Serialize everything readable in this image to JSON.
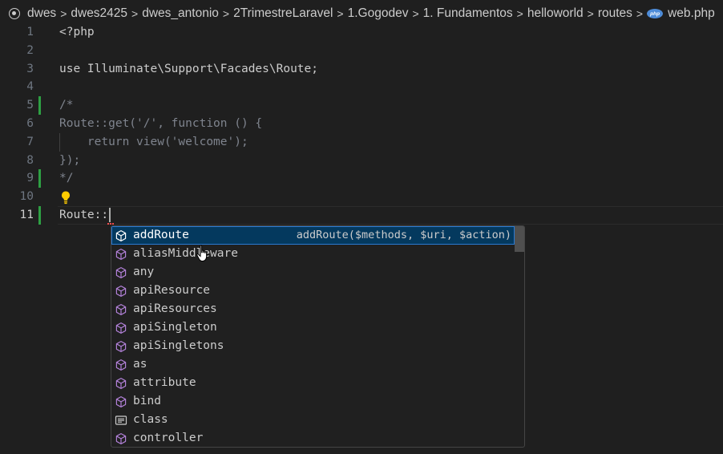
{
  "breadcrumb": {
    "items": [
      "dwes",
      "dwes2425",
      "dwes_antonio",
      "2TrimestreLaravel",
      "1.Gogodev",
      "1. Fundamentos",
      "helloworld",
      "routes"
    ],
    "file_badge": "php",
    "file_name": "web.php"
  },
  "editor": {
    "lines": [
      {
        "num": "1",
        "text": "<?php"
      },
      {
        "num": "2",
        "text": ""
      },
      {
        "num": "3",
        "text": "use Illuminate\\Support\\Facades\\Route;"
      },
      {
        "num": "4",
        "text": ""
      },
      {
        "num": "5",
        "text": "/*"
      },
      {
        "num": "6",
        "text": "Route::get('/', function () {"
      },
      {
        "num": "7",
        "text": "    return view('welcome');"
      },
      {
        "num": "8",
        "text": "});"
      },
      {
        "num": "9",
        "text": "*/"
      },
      {
        "num": "10",
        "text": ""
      },
      {
        "num": "11",
        "text": "Route::"
      }
    ]
  },
  "suggest": {
    "selected_detail": "addRoute($methods, $uri, $action)",
    "items": [
      {
        "label": "addRoute",
        "kind": "method-icon"
      },
      {
        "label": "aliasMiddleware",
        "kind": "method-icon"
      },
      {
        "label": "any",
        "kind": "method-icon"
      },
      {
        "label": "apiResource",
        "kind": "method-icon"
      },
      {
        "label": "apiResources",
        "kind": "method-icon"
      },
      {
        "label": "apiSingleton",
        "kind": "method-icon"
      },
      {
        "label": "apiSingletons",
        "kind": "method-icon"
      },
      {
        "label": "as",
        "kind": "method-icon"
      },
      {
        "label": "attribute",
        "kind": "method-icon"
      },
      {
        "label": "bind",
        "kind": "method-icon"
      },
      {
        "label": "class",
        "kind": "class-keyword-icon"
      },
      {
        "label": "controller",
        "kind": "method-icon"
      }
    ]
  },
  "colors": {
    "modified_gutter": "#2ea043",
    "method_icon": "#b180d7",
    "selection_bg": "#04395e",
    "php_badge": "#4e8cd8"
  }
}
